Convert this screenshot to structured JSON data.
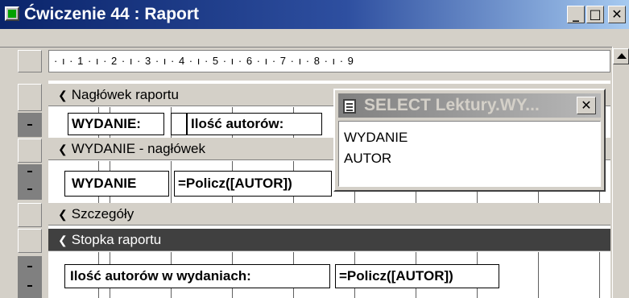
{
  "window": {
    "title": "Ćwiczenie 44 : Raport",
    "min_symbol": "_",
    "max_symbol": "□",
    "close_symbol": "✕"
  },
  "ruler": {
    "text": "· ı · 1 · ı · 2 · ı · 3 · ı · 4 · ı · 5 · ı · 6 · ı · 7 · ı · 8 · ı · 9"
  },
  "sections": {
    "report_header": "Nagłówek raportu",
    "group_header": "WYDANIE - nagłówek",
    "detail": "Szczegóły",
    "report_footer": "Stopka raportu",
    "arrow_glyph": "❮"
  },
  "controls": {
    "wydanie_label": "WYDANIE:",
    "ilosc_label": "Ilość autorów:",
    "wydanie_field": "WYDANIE",
    "policz_group": "=Policz([AUTOR])",
    "footer_label": "Ilość autorów w wydaniach:",
    "policz_footer": "=Policz([AUTOR])"
  },
  "field_list": {
    "title": "SELECT Lektury.WY...",
    "close_symbol": "✕",
    "fields": [
      "WYDANIE",
      "AUTOR"
    ]
  },
  "colors": {
    "title_bar_start": "#0a246a",
    "title_bar_end": "#a6caf0",
    "active_section": "#404040",
    "face": "#d4d0c8"
  }
}
